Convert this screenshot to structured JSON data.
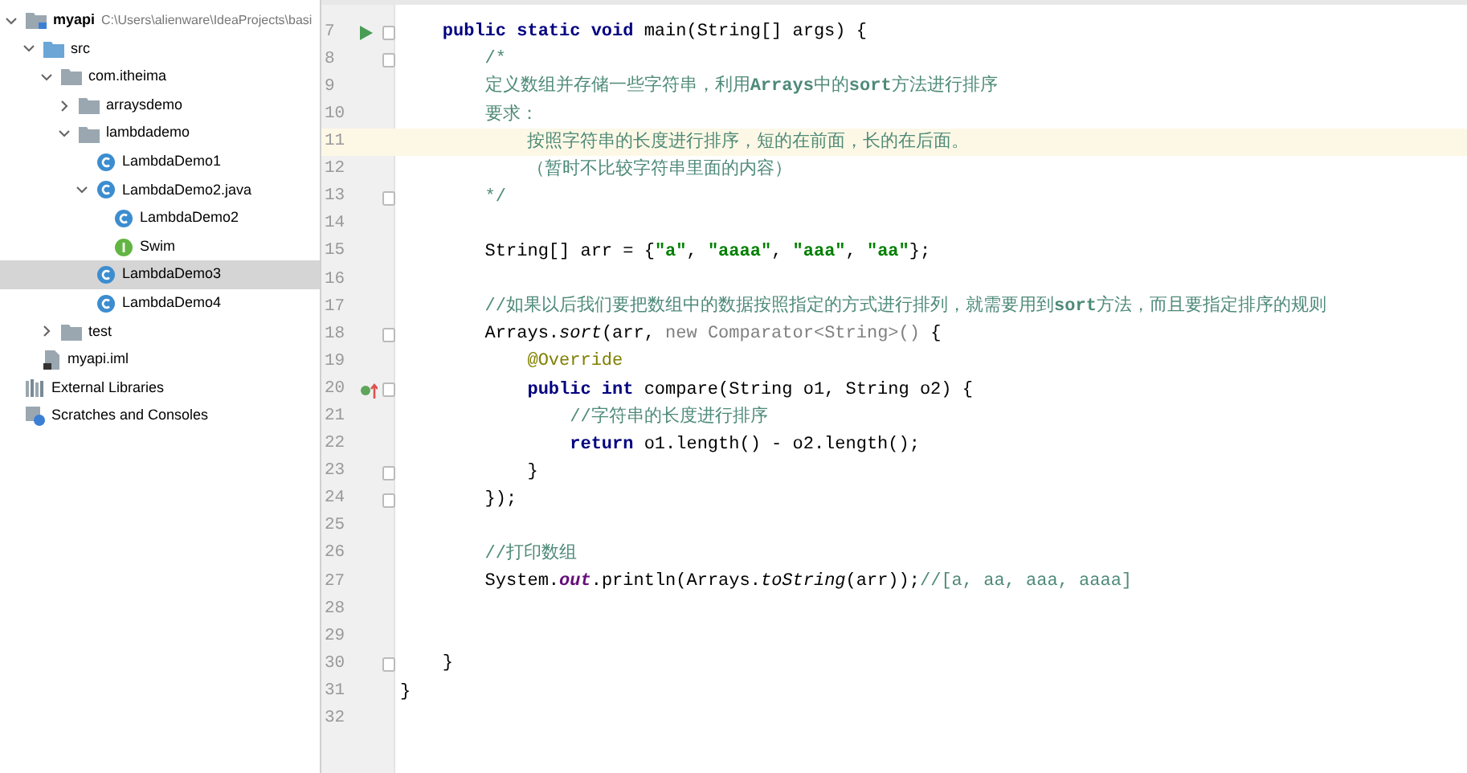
{
  "project_tree": [
    {
      "label": "myapi",
      "path": "C:\\Users\\alienware\\IdeaProjects\\basi",
      "kind": "module",
      "expanded": true,
      "selected": false,
      "children": [
        {
          "label": "src",
          "kind": "source",
          "expanded": true,
          "selected": false,
          "children": [
            {
              "label": "com.itheima",
              "kind": "package",
              "expanded": true,
              "selected": false,
              "children": [
                {
                  "label": "arraysdemo",
                  "kind": "package",
                  "expanded": false,
                  "selected": false
                },
                {
                  "label": "lambdademo",
                  "kind": "package",
                  "expanded": true,
                  "selected": false,
                  "children": [
                    {
                      "label": "LambdaDemo1",
                      "kind": "class",
                      "selected": false
                    },
                    {
                      "label": "LambdaDemo2.java",
                      "kind": "class",
                      "expanded": true,
                      "selected": false,
                      "children": [
                        {
                          "label": "LambdaDemo2",
                          "kind": "class",
                          "selected": false
                        },
                        {
                          "label": "Swim",
                          "kind": "interface",
                          "selected": false
                        }
                      ]
                    },
                    {
                      "label": "LambdaDemo3",
                      "kind": "class",
                      "selected": true
                    },
                    {
                      "label": "LambdaDemo4",
                      "kind": "class",
                      "selected": false
                    }
                  ]
                }
              ]
            },
            {
              "label": "test",
              "kind": "package",
              "expanded": false,
              "selected": false
            }
          ]
        },
        {
          "label": "myapi.iml",
          "kind": "file",
          "selected": false
        }
      ]
    },
    {
      "label": "External Libraries",
      "kind": "libraries",
      "selected": false
    },
    {
      "label": "Scratches and Consoles",
      "kind": "scratches",
      "selected": false
    }
  ],
  "editor": {
    "lines": [
      {
        "number": "7",
        "gutter_icon": {
          "kind": "run"
        },
        "fold": true,
        "current": false,
        "segments": [
          {
            "kind": "keyword",
            "text": "    public static void "
          },
          {
            "kind": "plain",
            "text": "main(String[] args) {"
          }
        ]
      },
      {
        "number": "8",
        "fold": true,
        "current": false,
        "segments": [
          {
            "kind": "comment",
            "text": "        /*"
          }
        ]
      },
      {
        "number": "9",
        "fold": false,
        "current": false,
        "segments": [
          {
            "kind": "comment",
            "text": "        定义数组并存储一些字符串，利用**Arrays**中的**sort**方法进行排序"
          }
        ]
      },
      {
        "number": "10",
        "fold": false,
        "current": false,
        "segments": [
          {
            "kind": "comment",
            "text": "        要求："
          }
        ]
      },
      {
        "number": "11",
        "fold": false,
        "current": true,
        "segments": [
          {
            "kind": "comment",
            "text": "            按照字符串的长度进行排序，短的在前面，长的在后面。"
          }
        ]
      },
      {
        "number": "12",
        "fold": false,
        "current": false,
        "segments": [
          {
            "kind": "comment",
            "text": "            （暂时不比较字符串里面的内容）"
          }
        ]
      },
      {
        "number": "13",
        "fold": true,
        "current": false,
        "segments": [
          {
            "kind": "comment",
            "text": "        */"
          }
        ]
      },
      {
        "number": "14",
        "fold": false,
        "current": false
      },
      {
        "number": "15",
        "fold": false,
        "current": false,
        "segments": [
          {
            "kind": "plain",
            "text": "        String[] arr = {"
          },
          {
            "kind": "string",
            "text": "\"a\""
          },
          {
            "kind": "plain",
            "text": ", "
          },
          {
            "kind": "string",
            "text": "\"aaaa\""
          },
          {
            "kind": "plain",
            "text": ", "
          },
          {
            "kind": "string",
            "text": "\"aaa\""
          },
          {
            "kind": "plain",
            "text": ", "
          },
          {
            "kind": "string",
            "text": "\"aa\""
          },
          {
            "kind": "plain",
            "text": "};"
          }
        ]
      },
      {
        "number": "16",
        "fold": false,
        "current": false
      },
      {
        "number": "17",
        "fold": false,
        "current": false,
        "segments": [
          {
            "kind": "comment",
            "text": "        //如果以后我们要把数组中的数据按照指定的方式进行排列，就需要用到**sort**方法，而且要指定排序的规则"
          }
        ]
      },
      {
        "number": "18",
        "fold": true,
        "current": false,
        "segments": [
          {
            "kind": "plain",
            "text": "        Arrays."
          },
          {
            "kind": "static",
            "text": "sort"
          },
          {
            "kind": "plain",
            "text": "(arr, "
          },
          {
            "kind": "hint",
            "text": "new Comparator<String>()"
          },
          {
            "kind": "plain",
            "text": " {"
          }
        ]
      },
      {
        "number": "19",
        "fold": false,
        "current": false,
        "segments": [
          {
            "kind": "annotation",
            "text": "            @Override"
          }
        ]
      },
      {
        "number": "20",
        "gutter_icon": {
          "kind": "override"
        },
        "fold": true,
        "current": false,
        "segments": [
          {
            "kind": "keyword",
            "text": "            public int "
          },
          {
            "kind": "plain",
            "text": "compare(String o1, String o2) {"
          }
        ]
      },
      {
        "number": "21",
        "fold": false,
        "current": false,
        "segments": [
          {
            "kind": "comment",
            "text": "                //字符串的长度进行排序"
          }
        ]
      },
      {
        "number": "22",
        "fold": false,
        "current": false,
        "segments": [
          {
            "kind": "keyword",
            "text": "                return "
          },
          {
            "kind": "plain",
            "text": "o1.length() - o2.length();"
          }
        ]
      },
      {
        "number": "23",
        "fold": true,
        "current": false,
        "segments": [
          {
            "kind": "plain",
            "text": "            }"
          }
        ]
      },
      {
        "number": "24",
        "fold": true,
        "current": false,
        "segments": [
          {
            "kind": "plain",
            "text": "        });"
          }
        ]
      },
      {
        "number": "25",
        "fold": false,
        "current": false
      },
      {
        "number": "26",
        "fold": false,
        "current": false,
        "segments": [
          {
            "kind": "comment",
            "text": "        //打印数组"
          }
        ]
      },
      {
        "number": "27",
        "fold": false,
        "current": false,
        "segments": [
          {
            "kind": "plain",
            "text": "        System."
          },
          {
            "kind": "field",
            "text": "out"
          },
          {
            "kind": "plain",
            "text": ".println(Arrays."
          },
          {
            "kind": "static",
            "text": "toString"
          },
          {
            "kind": "plain",
            "text": "(arr));"
          },
          {
            "kind": "comment",
            "text": "//[a, aa, aaa, aaaa]"
          }
        ]
      },
      {
        "number": "28",
        "fold": false,
        "current": false
      },
      {
        "number": "29",
        "fold": false,
        "current": false
      },
      {
        "number": "30",
        "fold": true,
        "current": false,
        "segments": [
          {
            "kind": "plain",
            "text": "    }"
          }
        ]
      },
      {
        "number": "31",
        "fold": false,
        "current": false,
        "segments": [
          {
            "kind": "plain",
            "text": "}"
          }
        ]
      },
      {
        "number": "32",
        "fold": false,
        "current": false
      }
    ]
  }
}
